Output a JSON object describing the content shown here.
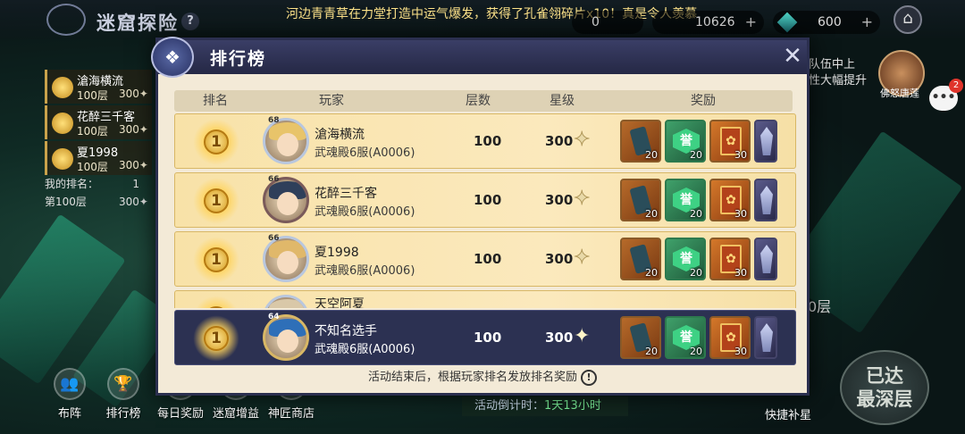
{
  "top": {
    "game_title": "迷窟探险",
    "help_glyph": "?",
    "marquee": "河边青青草在力堂打造中运气爆发，获得了孔雀翎碎片x10！真是令人羡慕",
    "res1_value": "0",
    "res2_value": "10626",
    "gem_value": "600",
    "plus_glyph": "+",
    "home_glyph": "⌂"
  },
  "left_list": {
    "items": [
      {
        "name": "滄海横流",
        "floor": "100层",
        "stars": "300✦"
      },
      {
        "name": "花醉三千客",
        "floor": "100层",
        "stars": "300✦"
      },
      {
        "name": "夏1998",
        "floor": "100层",
        "stars": "300✦"
      }
    ],
    "my_rank_label": "我的排名：",
    "my_rank_value": "1",
    "my_floor": "第100层",
    "my_stars": "300✦"
  },
  "right_side": {
    "notice_line1": "队伍中上",
    "notice_line2": "性大幅提升",
    "boss_label": "佛怒唐莲",
    "chat_badge": "2",
    "floor_hint": "0层",
    "quick_star": "快捷补星",
    "deep_btn_line1": "已达",
    "deep_btn_line2": "最深层"
  },
  "bottom_nav": [
    {
      "label": "布阵",
      "icon": "formation-icon",
      "glyph": "👥"
    },
    {
      "label": "排行榜",
      "icon": "trophy-icon",
      "glyph": "🏆"
    },
    {
      "label": "每日奖励",
      "icon": "gift-icon",
      "glyph": "🎁"
    },
    {
      "label": "迷窟增益",
      "icon": "buff-icon",
      "glyph": "✚"
    },
    {
      "label": "神匠商店",
      "icon": "shop-icon",
      "glyph": "⚒"
    }
  ],
  "countdown": {
    "label": "活动倒计时：",
    "value": "1天13小时"
  },
  "dialog": {
    "title": "排行榜",
    "emblem_glyph": "❖",
    "close_glyph": "✕",
    "columns": {
      "rank": "排名",
      "player": "玩家",
      "floor": "层数",
      "stars": "星级",
      "reward": "奖励"
    },
    "rows": [
      {
        "rank": "1",
        "level": "68",
        "name": "滄海横流",
        "server": "武魂殿6服(A0006)",
        "floor": "100",
        "stars": "300"
      },
      {
        "rank": "1",
        "level": "66",
        "name": "花醉三千客",
        "server": "武魂殿6服(A0006)",
        "floor": "100",
        "stars": "300"
      },
      {
        "rank": "1",
        "level": "66",
        "name": "夏1998",
        "server": "武魂殿6服(A0006)",
        "floor": "100",
        "stars": "300"
      },
      {
        "rank": "1",
        "level": "",
        "name": "天空阿夏",
        "server": "",
        "floor": "",
        "stars": ""
      }
    ],
    "my_row": {
      "rank": "1",
      "level": "64",
      "name": "不知名选手",
      "server": "武魂殿6服(A0006)",
      "floor": "100",
      "stars": "300"
    },
    "rewards": [
      {
        "icon": "fragment-scroll-icon",
        "count": "20",
        "glyph": ""
      },
      {
        "icon": "honor-token-icon",
        "count": "20",
        "glyph": "誉"
      },
      {
        "icon": "gift-card-icon",
        "count": "30",
        "glyph": "✿"
      },
      {
        "icon": "crystal-icon",
        "count": "",
        "glyph": ""
      }
    ],
    "star_glyph": "✦",
    "note": "活动结束后，根据玩家排名发放排名奖励",
    "note_icon_glyph": "!"
  }
}
